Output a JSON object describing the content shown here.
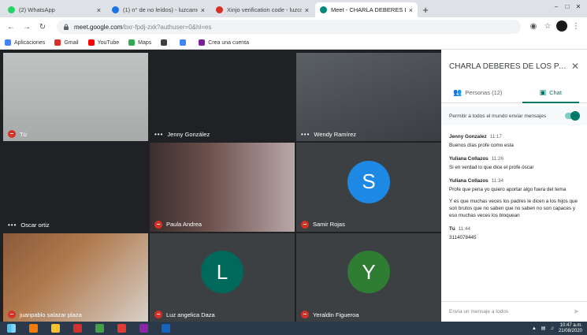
{
  "browser": {
    "tabs": [
      {
        "title": "(2) WhatsApp",
        "color": "#25d366",
        "active": false
      },
      {
        "title": "(1) n° de no leídos) - luzcame...",
        "color": "#1a73e8",
        "active": false
      },
      {
        "title": "Xinjo verification code - luzcm...",
        "color": "#d93025",
        "active": false
      },
      {
        "title": "Meet - CHARLA DEBERES D...",
        "color": "#00897b",
        "active": true
      }
    ],
    "new_tab": "+",
    "url_host": "meet.google.com",
    "url_path": "/bxr-fpdj-zxk?authuser=0&hl=es",
    "bookmarks": [
      {
        "label": "Aplicaciones",
        "color": "#4285f4"
      },
      {
        "label": "Gmail",
        "color": "#d93025"
      },
      {
        "label": "YouTube",
        "color": "#ff0000"
      },
      {
        "label": "Maps",
        "color": "#34a853"
      },
      {
        "label": "",
        "color": "#3c4043"
      },
      {
        "label": "",
        "color": "#4285f4"
      },
      {
        "label": "Crea una cuenta",
        "color": "#7b1fa2"
      }
    ]
  },
  "meet": {
    "participants": [
      {
        "name": "Tú",
        "muted": true,
        "tile": "t1"
      },
      {
        "name": "Jenny González",
        "muted": false,
        "tile": "t2"
      },
      {
        "name": "Wendy Ramírez",
        "muted": false,
        "tile": "t3"
      },
      {
        "name": "Oscar ortiz",
        "muted": false,
        "tile": "t4"
      },
      {
        "name": "Paula Andrea",
        "muted": true,
        "tile": "t5"
      },
      {
        "name": "Samir Rojas",
        "muted": true,
        "tile": "t6",
        "avatar_letter": "S",
        "avatar_color": "#1e88e5"
      },
      {
        "name": "juanpablo salazar plaza",
        "muted": true,
        "tile": "t7"
      },
      {
        "name": "Luz angelica Daza",
        "muted": true,
        "tile": "t8",
        "avatar_letter": "L",
        "avatar_color": "#00695c"
      },
      {
        "name": "Yeraldin Figueroa",
        "muted": true,
        "tile": "t9",
        "avatar_letter": "Y",
        "avatar_color": "#2e7d32"
      }
    ]
  },
  "chat": {
    "title": "CHARLA DEBERES DE LOS PADRE...",
    "tab_people": "Personas (12)",
    "tab_chat": "Chat",
    "permission_text": "Permitir a todos el mundo enviar mensajes",
    "messages": [
      {
        "author": "Jenny Gonzalez",
        "time": "11:17",
        "lines": [
          "Buenos días profe como esta"
        ]
      },
      {
        "author": "Yuliana Collazos",
        "time": "11:26",
        "lines": [
          "Si en verdad lo que dice el profe óscar"
        ]
      },
      {
        "author": "Yuliana Collazos",
        "time": "11:34",
        "lines": [
          "Profe que pena yo quiero aportar algo fuera del tema",
          "Y es que muchas veces los padres le dicen a los hijos que son brutos que no saben que no saben no son capaces y eso muchas veces los bloquean"
        ]
      },
      {
        "author": "Tú",
        "time": "11:44",
        "lines": [
          "3114078445"
        ]
      }
    ],
    "composer_placeholder": "Envía un mensaje a todos"
  },
  "taskbar": {
    "apps": [
      {
        "name": "start",
        "color": "#4fc3f7"
      },
      {
        "name": "media",
        "color": "#f57c00"
      },
      {
        "name": "files",
        "color": "#fbc02d"
      },
      {
        "name": "acrobat",
        "color": "#d32f2f"
      },
      {
        "name": "chrome-alt",
        "color": "#43a047"
      },
      {
        "name": "chrome",
        "color": "#e53935"
      },
      {
        "name": "store",
        "color": "#8e24aa"
      },
      {
        "name": "word",
        "color": "#1565c0"
      }
    ],
    "time": "10:47 a.m.",
    "date": "21/08/2020"
  }
}
